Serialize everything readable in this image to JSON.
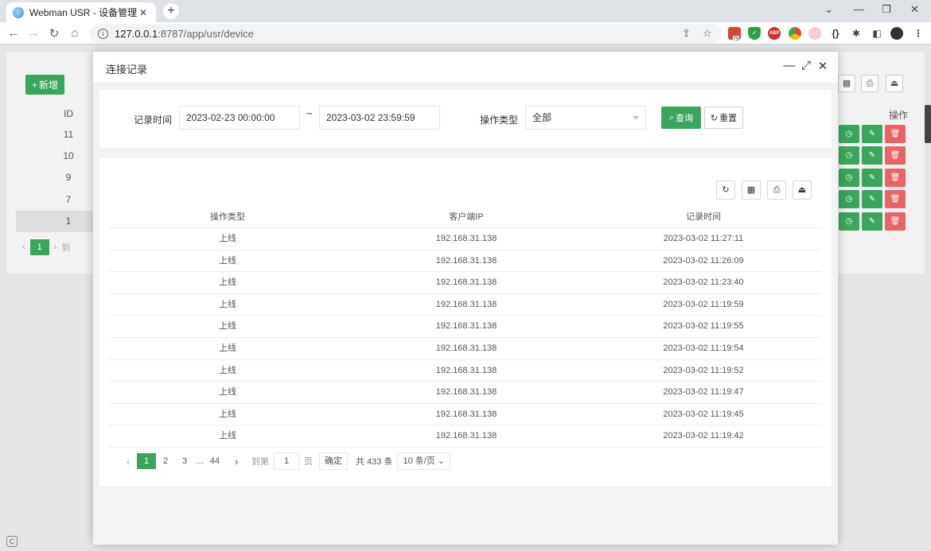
{
  "browser": {
    "tab_title": "Webman USR - 设备管理",
    "tab_close": "✕",
    "new_tab": "+",
    "url_host": "127.0.0.1",
    "url_path": ":8787/app/usr/device",
    "ext_badge": "75",
    "ext_abp": "ABP"
  },
  "background_page": {
    "add_button": "新增",
    "id_header": "ID",
    "ids": [
      "11",
      "10",
      "9",
      "7",
      "1"
    ],
    "op_header": "操作",
    "pager_current": "1",
    "pager_goto": "到"
  },
  "modal": {
    "title": "连接记录",
    "search": {
      "time_label": "记录时间",
      "start_time": "2023-02-23 00:00:00",
      "separator": "~",
      "end_time": "2023-03-02 23:59:59",
      "type_label": "操作类型",
      "type_value": "全部",
      "query_button": "查询",
      "reset_button": "重置"
    },
    "table": {
      "columns": [
        "操作类型",
        "客户端IP",
        "记录时间"
      ],
      "rows": [
        [
          "上线",
          "192.168.31.138",
          "2023-03-02 11:27:11"
        ],
        [
          "上线",
          "192.168.31.138",
          "2023-03-02 11:26:09"
        ],
        [
          "上线",
          "192.168.31.138",
          "2023-03-02 11:23:40"
        ],
        [
          "上线",
          "192.168.31.138",
          "2023-03-02 11:19:59"
        ],
        [
          "上线",
          "192.168.31.138",
          "2023-03-02 11:19:55"
        ],
        [
          "上线",
          "192.168.31.138",
          "2023-03-02 11:19:54"
        ],
        [
          "上线",
          "192.168.31.138",
          "2023-03-02 11:19:52"
        ],
        [
          "上线",
          "192.168.31.138",
          "2023-03-02 11:19:47"
        ],
        [
          "上线",
          "192.168.31.138",
          "2023-03-02 11:19:45"
        ],
        [
          "上线",
          "192.168.31.138",
          "2023-03-02 11:19:42"
        ]
      ]
    },
    "pager": {
      "pages": [
        "1",
        "2",
        "3"
      ],
      "ellipsis": "…",
      "last_page": "44",
      "goto_label": "到第",
      "goto_value": "1",
      "page_unit": "页",
      "confirm": "确定",
      "total": "共 433 条",
      "page_size": "10 条/页"
    }
  },
  "colors": {
    "primary_green": "#3aa65b",
    "danger_red": "#e96565"
  }
}
